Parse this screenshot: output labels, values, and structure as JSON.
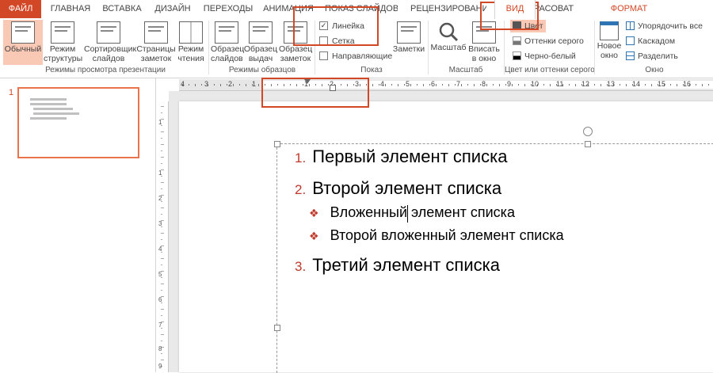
{
  "tabs": [
    {
      "label": "ФАЙЛ"
    },
    {
      "label": "ГЛАВНАЯ"
    },
    {
      "label": "ВСТАВКА"
    },
    {
      "label": "ДИЗАЙН"
    },
    {
      "label": "ПЕРЕХОДЫ"
    },
    {
      "label": "АНИМАЦИЯ"
    },
    {
      "label": "ПОКАЗ СЛАЙДОВ"
    },
    {
      "label": "РЕЦЕНЗИРОВАНИЕ"
    },
    {
      "label": "ВИД"
    },
    {
      "label": "РАСОВАТ"
    },
    {
      "label": "ФОРМАТ"
    }
  ],
  "groups": {
    "presentation_views": {
      "label": "Режимы просмотра презентации",
      "buttons": [
        {
          "label1": "Обычный",
          "label2": ""
        },
        {
          "label1": "Режим",
          "label2": "структуры"
        },
        {
          "label1": "Сортировщик",
          "label2": "слайдов"
        },
        {
          "label1": "Страницы",
          "label2": "заметок"
        },
        {
          "label1": "Режим",
          "label2": "чтения"
        }
      ]
    },
    "master_views": {
      "label": "Режимы образцов",
      "buttons": [
        {
          "label1": "Образец",
          "label2": "слайдов"
        },
        {
          "label1": "Образец",
          "label2": "выдач"
        },
        {
          "label1": "Образец",
          "label2": "заметок"
        }
      ]
    },
    "show": {
      "label": "Показ",
      "checkboxes": [
        {
          "label": "Линейка",
          "checked": true
        },
        {
          "label": "Сетка",
          "checked": false
        },
        {
          "label": "Направляющие",
          "checked": false
        }
      ],
      "notes_label": "Заметки"
    },
    "zoom": {
      "label": "Масштаб",
      "zoom_label": "Масштаб",
      "fit1": "Вписать",
      "fit2": "в окно"
    },
    "color": {
      "label": "Цвет или оттенки серого",
      "items": [
        {
          "label": "Цвет"
        },
        {
          "label": "Оттенки серого"
        },
        {
          "label": "Черно-белый"
        }
      ]
    },
    "window": {
      "label": "Окно",
      "new_window1": "Новое",
      "new_window2": "окно",
      "items": [
        {
          "label": "Упорядочить все"
        },
        {
          "label": "Каскадом"
        },
        {
          "label": "Разделить"
        }
      ]
    }
  },
  "ruler": {
    "numbers": [
      "4",
      "3",
      "2",
      "1",
      "1",
      "2",
      "3",
      "4",
      "5",
      "6",
      "7",
      "8",
      "9",
      "10",
      "11",
      "12",
      "13",
      "14",
      "15",
      "16"
    ],
    "v_numbers": [
      "1",
      "1",
      "2",
      "3",
      "4",
      "5",
      "6",
      "7",
      "8",
      "9"
    ]
  },
  "slide_panel": {
    "number": "1"
  },
  "slide": {
    "items": [
      {
        "num": "1.",
        "text": "Первый элемент списка"
      },
      {
        "num": "2.",
        "text": "Второй элемент списка"
      },
      {
        "num": "3.",
        "text": "Третий элемент списка"
      }
    ],
    "subitems": [
      {
        "text": "Вложенный элемент списка"
      },
      {
        "text": "Второй вложенный элемент списка"
      }
    ]
  },
  "colors": {
    "accent": "#d24726",
    "bullet": "#c0392b",
    "active_bg": "#f9c9b6"
  }
}
